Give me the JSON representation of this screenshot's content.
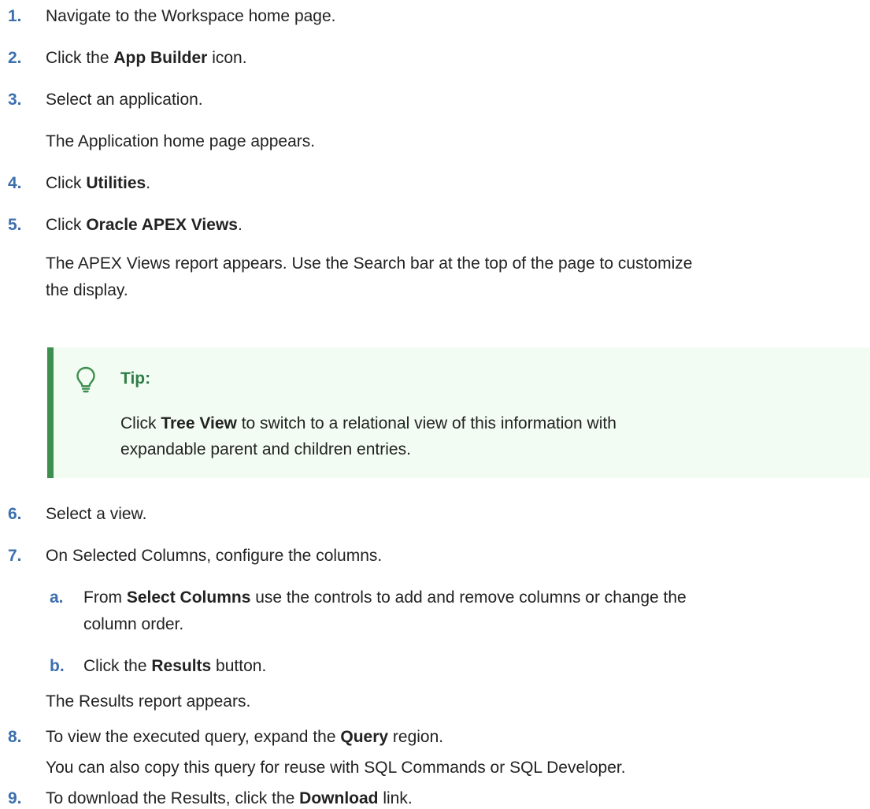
{
  "steps": [
    {
      "num": "1.",
      "text": "Navigate to the Workspace home page."
    },
    {
      "num": "2.",
      "pre": "Click the ",
      "bold": "App Builder",
      "post": " icon."
    },
    {
      "num": "3.",
      "text": "Select an application.",
      "note": "The Application home page appears."
    },
    {
      "num": "4.",
      "pre": "Click ",
      "bold": "Utilities",
      "post": "."
    },
    {
      "num": "5.",
      "pre": "Click ",
      "bold": "Oracle APEX Views",
      "post": ".",
      "note_line1": "The APEX Views report appears. Use the Search bar at the top of the page to customize",
      "note_line2": "the display."
    },
    {
      "num": "6.",
      "text": "Select a view."
    },
    {
      "num": "7.",
      "text": "On Selected Columns, configure the columns.",
      "substeps": [
        {
          "num": "a.",
          "pre": "From ",
          "bold": "Select Columns",
          "post": " use the controls to add and remove columns or change the",
          "line2": "column order."
        },
        {
          "num": "b.",
          "pre": "Click the ",
          "bold": "Results",
          "post": " button."
        }
      ],
      "note": "The Results report appears."
    },
    {
      "num": "8.",
      "pre": "To view the executed query, expand the ",
      "bold": "Query",
      "post": " region.",
      "note": "You can also copy this query for reuse with SQL Commands or SQL Developer."
    },
    {
      "num": "9.",
      "pre": "To download the Results, click the ",
      "bold": "Download",
      "post": " link."
    }
  ],
  "tip": {
    "label": "Tip:",
    "pre": "Click ",
    "bold": "Tree View",
    "post_line1": " to switch to a relational view of this information with",
    "line2": "expandable parent and children entries.",
    "icon": "lightbulb-icon"
  },
  "colors": {
    "step_number": "#3d6fae",
    "tip_accent": "#3e8e50",
    "tip_background": "#f3fcf3"
  }
}
